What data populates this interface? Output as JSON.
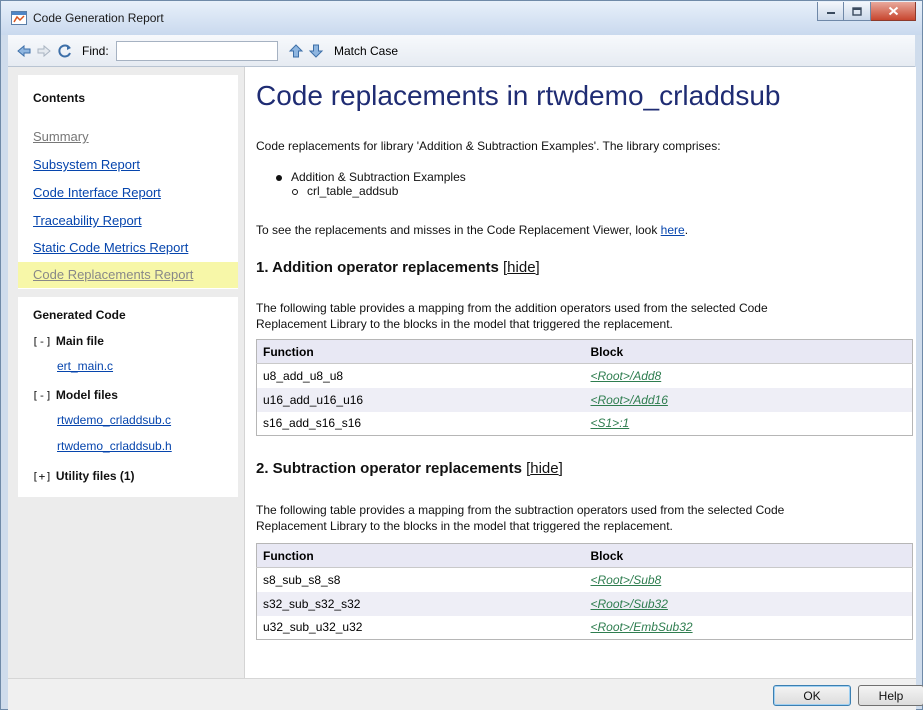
{
  "window": {
    "title": "Code Generation Report",
    "controls": [
      "minimize-icon",
      "maximize-icon",
      "close-icon"
    ]
  },
  "toolbar": {
    "find_label": "Find:",
    "find_value": "",
    "match_case_label": "Match Case",
    "icons": [
      "back-arrow-icon",
      "forward-arrow-icon",
      "refresh-icon",
      "find-up-icon",
      "find-down-icon"
    ]
  },
  "sidebar": {
    "contents_heading": "Contents",
    "nav": [
      {
        "label": "Summary"
      },
      {
        "label": "Subsystem Report"
      },
      {
        "label": "Code Interface Report"
      },
      {
        "label": "Traceability Report"
      },
      {
        "label": "Static Code Metrics Report"
      },
      {
        "label": "Code Replacements Report",
        "active": true
      }
    ],
    "generated_heading": "Generated Code",
    "groups": [
      {
        "toggle": "[-]",
        "label": "Main file",
        "files": [
          "ert_main.c"
        ]
      },
      {
        "toggle": "[-]",
        "label": "Model files",
        "files": [
          "rtwdemo_crladdsub.c",
          "rtwdemo_crladdsub.h"
        ]
      },
      {
        "toggle": "[+]",
        "label": "Utility files (1)",
        "files": []
      }
    ]
  },
  "content": {
    "title": "Code replacements in rtwdemo_crladdsub",
    "intro": "Code replacements for library 'Addition & Subtraction Examples'. The library comprises:",
    "bullets": {
      "level1": "Addition & Subtraction Examples",
      "level2": "crl_table_addsub"
    },
    "viewer_text": "To see the replacements and misses in the Code Replacement Viewer, look ",
    "viewer_link": "here",
    "viewer_end": ".",
    "sections": [
      {
        "heading": "1. Addition operator replacements",
        "hide_label": "hide",
        "description_line1": "The following table provides a mapping from the addition operators used from the selected Code",
        "description_line2": "Replacement Library to the blocks in the model that triggered the replacement.",
        "columns": [
          "Function",
          "Block"
        ],
        "rows": [
          {
            "function": "u8_add_u8_u8",
            "block": "<Root>/Add8"
          },
          {
            "function": "u16_add_u16_u16",
            "block": "<Root>/Add16"
          },
          {
            "function": "s16_add_s16_s16",
            "block": "<S1>:1"
          }
        ]
      },
      {
        "heading": "2. Subtraction operator replacements",
        "hide_label": "hide",
        "description_line1": "The following table provides a mapping from the subtraction operators used from the selected Code",
        "description_line2": "Replacement Library to the blocks in the model that triggered the replacement.",
        "columns": [
          "Function",
          "Block"
        ],
        "rows": [
          {
            "function": "s8_sub_s8_s8",
            "block": "<Root>/Sub8"
          },
          {
            "function": "s32_sub_s32_s32",
            "block": "<Root>/Sub32"
          },
          {
            "function": "u32_sub_u32_u32",
            "block": "<Root>/EmbSub32"
          }
        ]
      }
    ]
  },
  "buttons": {
    "ok": "OK",
    "help": "Help"
  }
}
